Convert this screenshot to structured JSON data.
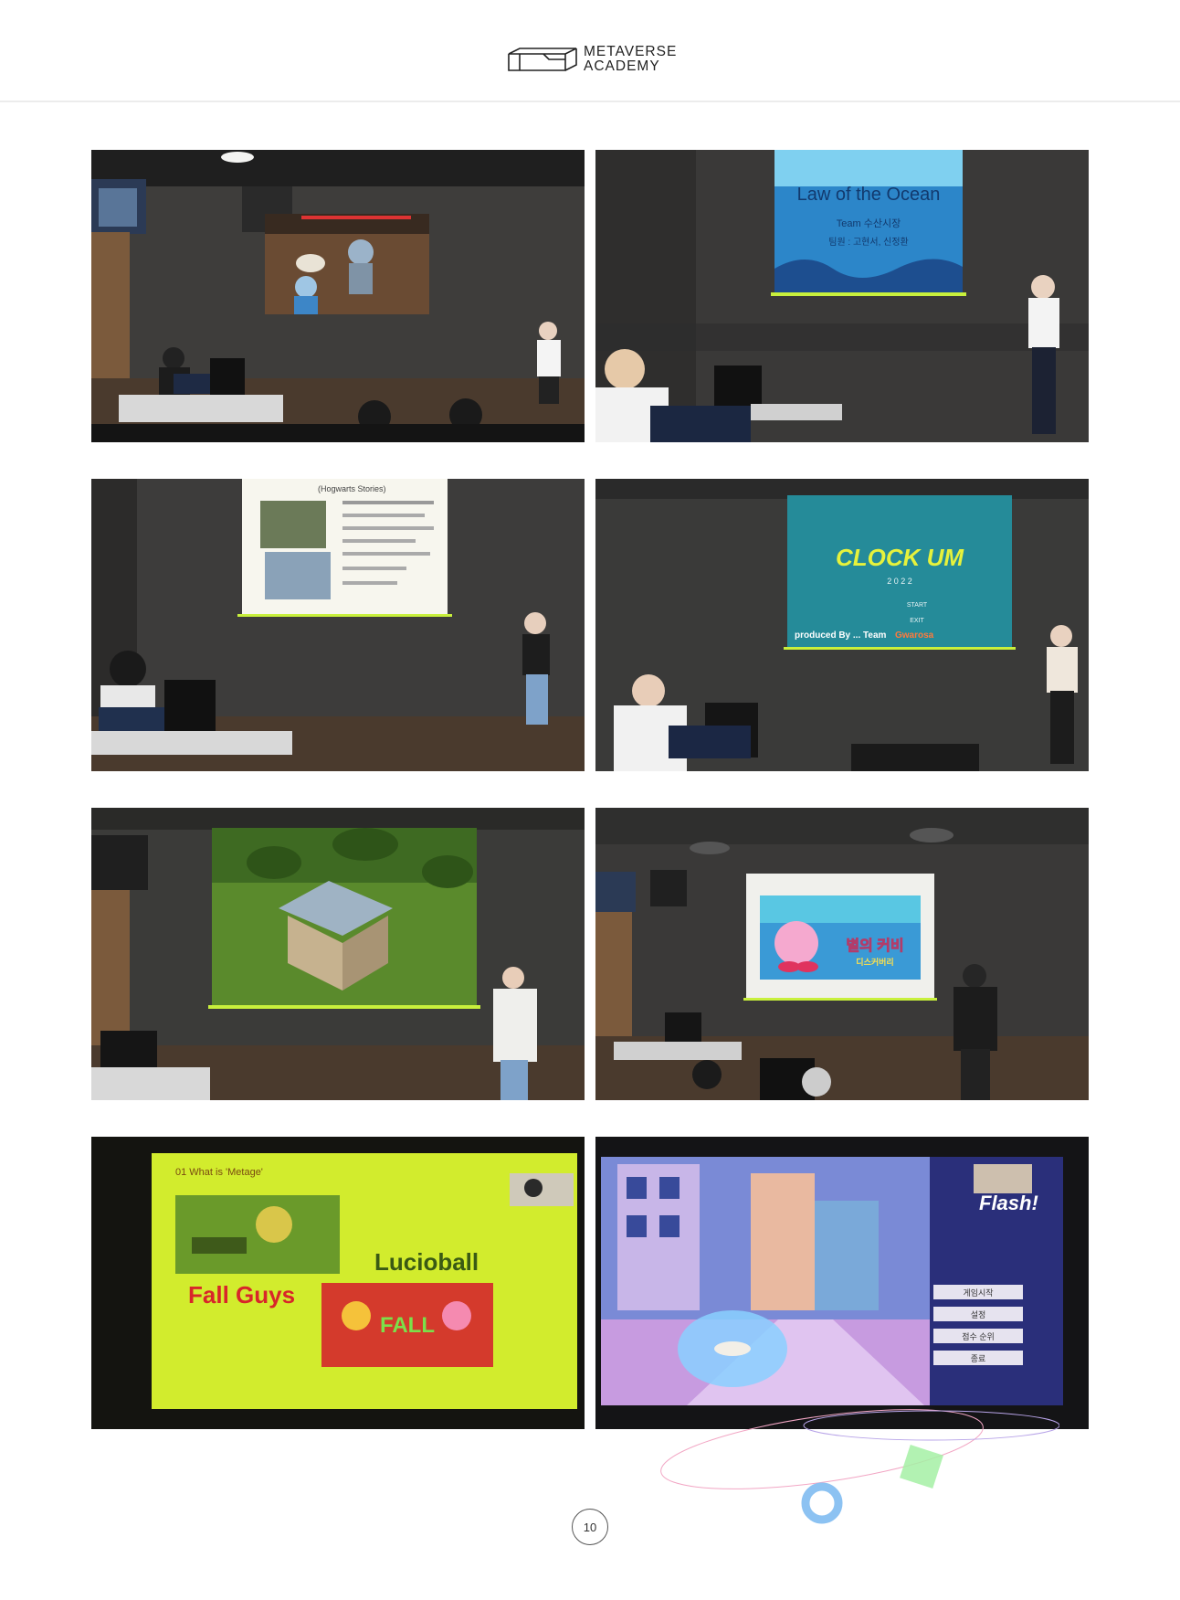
{
  "header": {
    "brand_line1": "METAVERSE",
    "brand_line2": "ACADEMY"
  },
  "photos": [
    {
      "name": "photo-robot-boss-game",
      "screen_text": ""
    },
    {
      "name": "photo-law-of-the-ocean",
      "screen_title": "Law of the Ocean",
      "screen_line2": "Team 수산시장",
      "screen_line3": "팀원 : 고현서, 신정환"
    },
    {
      "name": "photo-hogwarts-stories",
      "screen_title": "(Hogwarts Stories)"
    },
    {
      "name": "photo-clockum",
      "screen_title": "CLOCK UM",
      "screen_year": "2 0 2 2",
      "menu_start": "START",
      "menu_exit": "EXIT",
      "credit": "produced By ... Team",
      "team": "Gwarosa"
    },
    {
      "name": "photo-farm-house-game",
      "screen_text": ""
    },
    {
      "name": "photo-kirby-discovery",
      "screen_caption": "별의 커비",
      "screen_sub": "디스커버리"
    },
    {
      "name": "photo-metage-presentation",
      "slide_heading": "01 What is 'Metage'",
      "label_lucioball": "Lucioball",
      "label_fallguys": "Fall Guys",
      "fall_badge": "FALL"
    },
    {
      "name": "photo-flash-game",
      "game_title": "Flash!",
      "menu": [
        "게임시작",
        "설정",
        "점수 순위",
        "종료"
      ]
    }
  ],
  "footer": {
    "page_number": "10"
  },
  "colors": {
    "accent_green": "#c8f03c",
    "accent_blue": "#7fb9ef",
    "accent_pink": "#f28bb8"
  }
}
